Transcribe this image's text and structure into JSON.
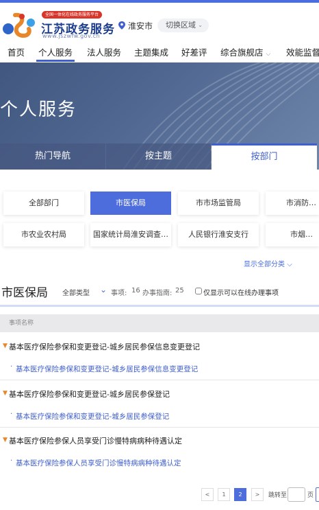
{
  "brand": {
    "badge": "全国一体化在线政务服务平台",
    "title": "江苏政务服务",
    "url": "www.jszwfw.gov.cn",
    "city": "淮安市",
    "switch_region": "切换区域"
  },
  "nav": {
    "items": [
      "首页",
      "个人服务",
      "法人服务",
      "主题集成",
      "好差评",
      "综合旗舰店",
      "效能监督"
    ],
    "active_index": 1
  },
  "banner": {
    "title": "个人服务",
    "tabs": [
      "热门导航",
      "按主题",
      "按部门"
    ],
    "active_tab": 2
  },
  "departments": [
    "全部部门",
    "市医保局",
    "市市场监管局",
    "市消防支队",
    "市农业农村局",
    "国家统计局淮安调查…",
    "人民银行淮安支行",
    "市烟草局"
  ],
  "active_department": 1,
  "show_all": "显示全部分类",
  "filter": {
    "section_title": "市医保局",
    "type_label": "全部类型",
    "items_label": "事项:",
    "items_count": "16",
    "guides_label": "办事指南:",
    "guides_count": "25",
    "online_only_label": "仅显示可以在线办理事项"
  },
  "table": {
    "column_header": "事项名称",
    "items": [
      {
        "title": "基本医疗保险参保和变更登记-城乡居民参保信息变更登记",
        "link": "基本医疗保险参保和变更登记-城乡居民参保信息变更登记"
      },
      {
        "title": "基本医疗保险参保和变更登记-城乡居民参保登记",
        "link": "基本医疗保险参保和变更登记-城乡居民参保登记"
      },
      {
        "title": "基本医疗保险参保人员享受门诊慢特病病种待遇认定",
        "link": "基本医疗保险参保人员享受门诊慢特病病种待遇认定"
      }
    ]
  },
  "pagination": {
    "prev": "<",
    "pages": [
      "1",
      "2"
    ],
    "current": "2",
    "next": ">",
    "jump_label": "跳转至",
    "page_unit": "页"
  },
  "colors": {
    "accent": "#4a6ee0",
    "active_bg": "#4e6ddd",
    "badge_red": "#d9362b",
    "flag_orange": "#e8862a"
  }
}
